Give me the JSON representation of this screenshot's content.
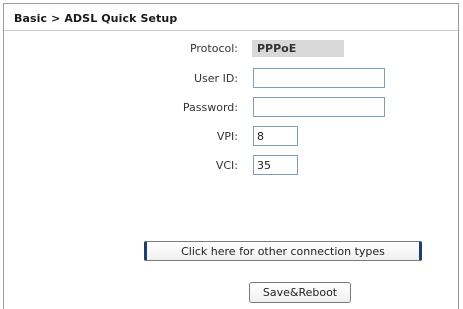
{
  "breadcrumb": "Basic > ADSL Quick Setup",
  "form": {
    "protocol_label": "Protocol:",
    "protocol_value": "PPPoE",
    "userid_label": "User ID:",
    "userid_value": "",
    "password_label": "Password:",
    "password_value": "",
    "vpi_label": "VPI:",
    "vpi_value": "8",
    "vci_label": "VCI:",
    "vci_value": "35"
  },
  "buttons": {
    "other_connection_types": "Click here for other connection types",
    "save_reboot": "Save&Reboot"
  }
}
